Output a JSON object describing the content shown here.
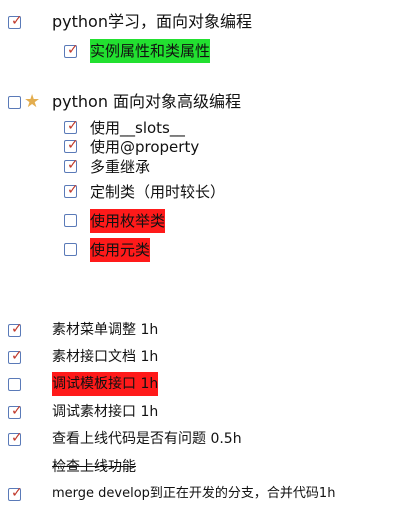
{
  "items": [
    {
      "text": "python学习，面向对象编程",
      "checked": true
    },
    {
      "text": "实例属性和类属性",
      "checked": true,
      "highlight": "#22e030"
    },
    {
      "text": "python 面向对象高级编程",
      "checked": false,
      "star": "star-icon"
    },
    {
      "text": "使用__slots__",
      "checked": true
    },
    {
      "text": "使用@property",
      "checked": true
    },
    {
      "text": "多重继承",
      "checked": true
    },
    {
      "text": "定制类（用时较长）",
      "checked": true
    },
    {
      "text": "使用枚举类",
      "checked": false,
      "highlight": "#ff1a1a"
    },
    {
      "text": "使用元类",
      "checked": false,
      "highlight": "#ff1a1a"
    },
    {
      "text": "素材菜单调整 1h",
      "checked": true
    },
    {
      "text": "素材接口文档 1h",
      "checked": true
    },
    {
      "text": "调试模板接口 1h",
      "checked": false,
      "highlight": "#ff1a1a"
    },
    {
      "text": "调试素材接口 1h",
      "checked": true
    },
    {
      "text": "查看上线代码是否有问题 0.5h",
      "checked": true
    },
    {
      "text": "检查上线功能",
      "checked": null,
      "strikethrough": true
    },
    {
      "text": "merge develop到正在开发的分支，合并代码1h",
      "checked": true
    }
  ],
  "icons": {
    "check": "✓",
    "star": "★"
  },
  "colors": {
    "checkbox_border": "#5a7ab8",
    "checkmark": "#c0392b",
    "star": "#e3ad4e"
  }
}
